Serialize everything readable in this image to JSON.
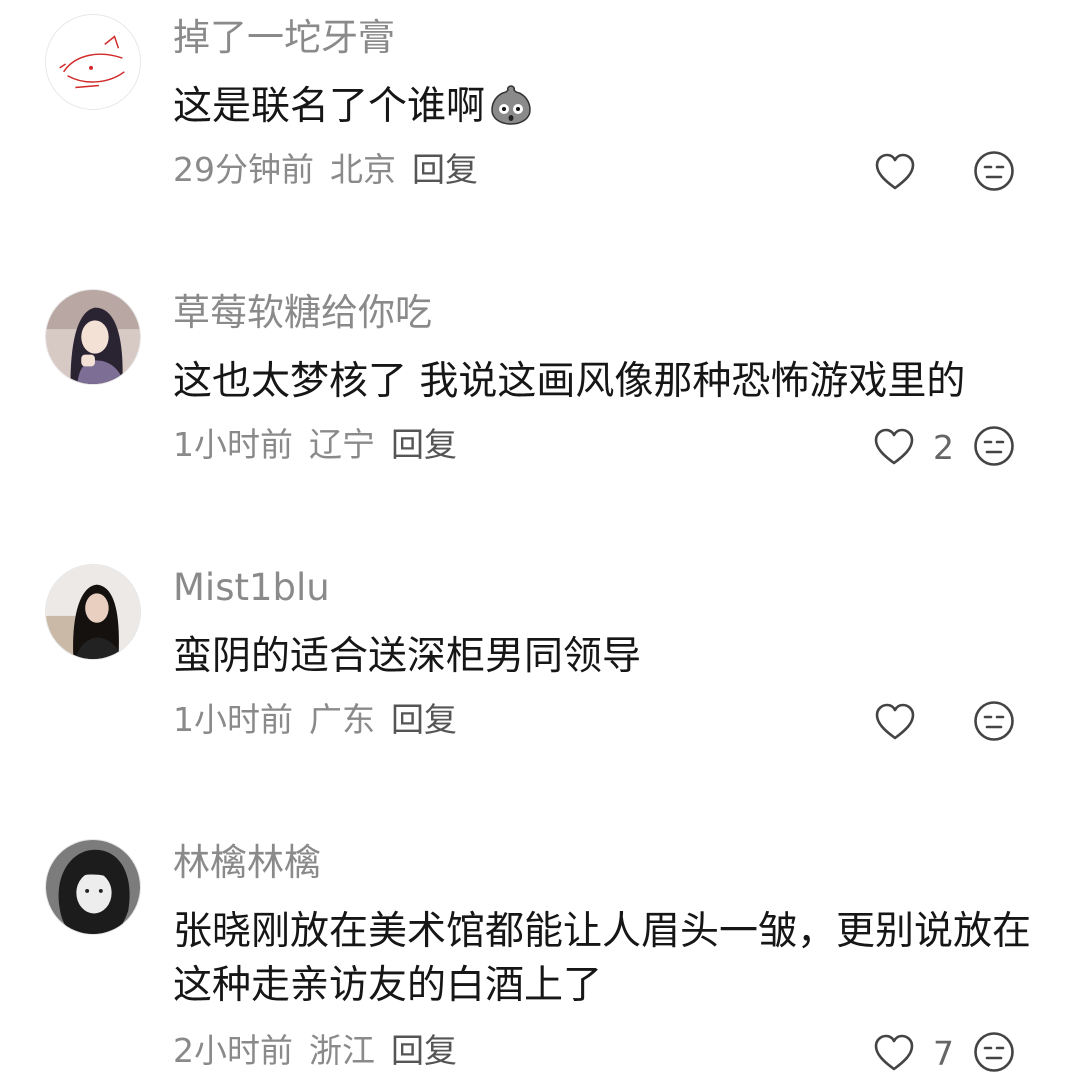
{
  "comments": [
    {
      "username": "掉了一坨牙膏",
      "text": "这是联名了个谁啊",
      "emoji": "shocked-face-emoji",
      "time": "29分钟前",
      "location": "北京",
      "reply_label": "回复",
      "likes": ""
    },
    {
      "username": "草莓软糖给你吃",
      "text": "这也太梦核了 我说这画风像那种恐怖游戏里的",
      "time": "1小时前",
      "location": "辽宁",
      "reply_label": "回复",
      "likes": "2"
    },
    {
      "username": "Mist1blu",
      "text": "蛮阴的适合送深柜男同领导",
      "time": "1小时前",
      "location": "广东",
      "reply_label": "回复",
      "likes": ""
    },
    {
      "username": "林檎林檎",
      "text": "张晓刚放在美术馆都能让人眉头一皱，更别说放在这种走亲访友的白酒上了",
      "time": "2小时前",
      "location": "浙江",
      "reply_label": "回复",
      "likes": "7"
    }
  ],
  "icons": {
    "like": "heart-outline-icon",
    "dislike": "unamused-face-icon"
  },
  "colors": {
    "username": "#8a8a8a",
    "body_text": "#161616",
    "meta": "#8a8a8a",
    "icon": "#444444"
  }
}
